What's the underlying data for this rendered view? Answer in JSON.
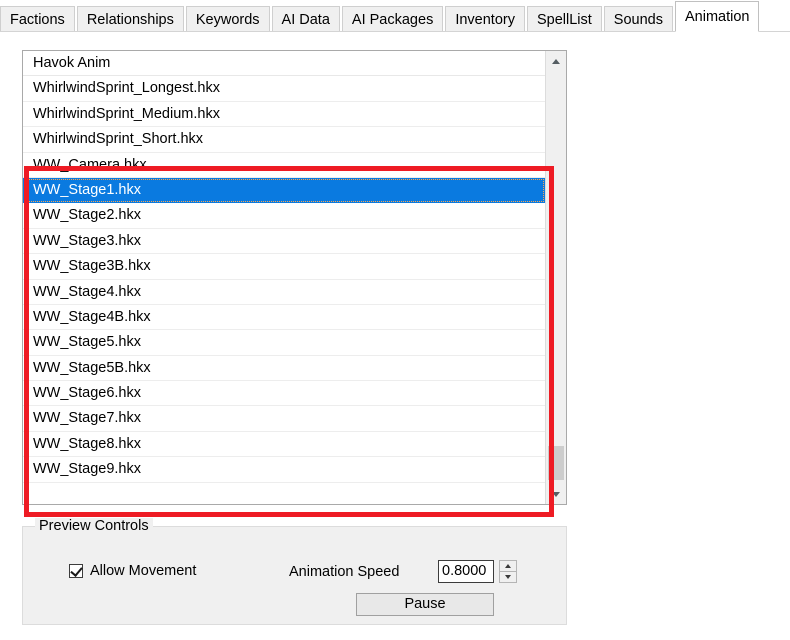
{
  "tabs": [
    {
      "label": "Factions",
      "active": false
    },
    {
      "label": "Relationships",
      "active": false
    },
    {
      "label": "Keywords",
      "active": false
    },
    {
      "label": "AI Data",
      "active": false
    },
    {
      "label": "AI Packages",
      "active": false
    },
    {
      "label": "Inventory",
      "active": false
    },
    {
      "label": "SpellList",
      "active": false
    },
    {
      "label": "Sounds",
      "active": false
    },
    {
      "label": "Animation",
      "active": true
    }
  ],
  "animation_list": {
    "header": "Havok Anim",
    "selected_index": 4,
    "items": [
      "WhirlwindSprint_Longest.hkx",
      "WhirlwindSprint_Medium.hkx",
      "WhirlwindSprint_Short.hkx",
      "WW_Camera.hkx",
      "WW_Stage1.hkx",
      "WW_Stage2.hkx",
      "WW_Stage3.hkx",
      "WW_Stage3B.hkx",
      "WW_Stage4.hkx",
      "WW_Stage4B.hkx",
      "WW_Stage5.hkx",
      "WW_Stage5B.hkx",
      "WW_Stage6.hkx",
      "WW_Stage7.hkx",
      "WW_Stage8.hkx",
      "WW_Stage9.hkx"
    ]
  },
  "preview_controls": {
    "title": "Preview Controls",
    "allow_movement_label": "Allow Movement",
    "allow_movement_checked": true,
    "animation_speed_label": "Animation Speed",
    "animation_speed_value": "0.8000",
    "pause_label": "Pause"
  },
  "annotation": {
    "color": "#ee1b24"
  },
  "colors": {
    "selection": "#0a7ae0",
    "panel": "#f0f0f0",
    "border": "#a9a9a9"
  }
}
